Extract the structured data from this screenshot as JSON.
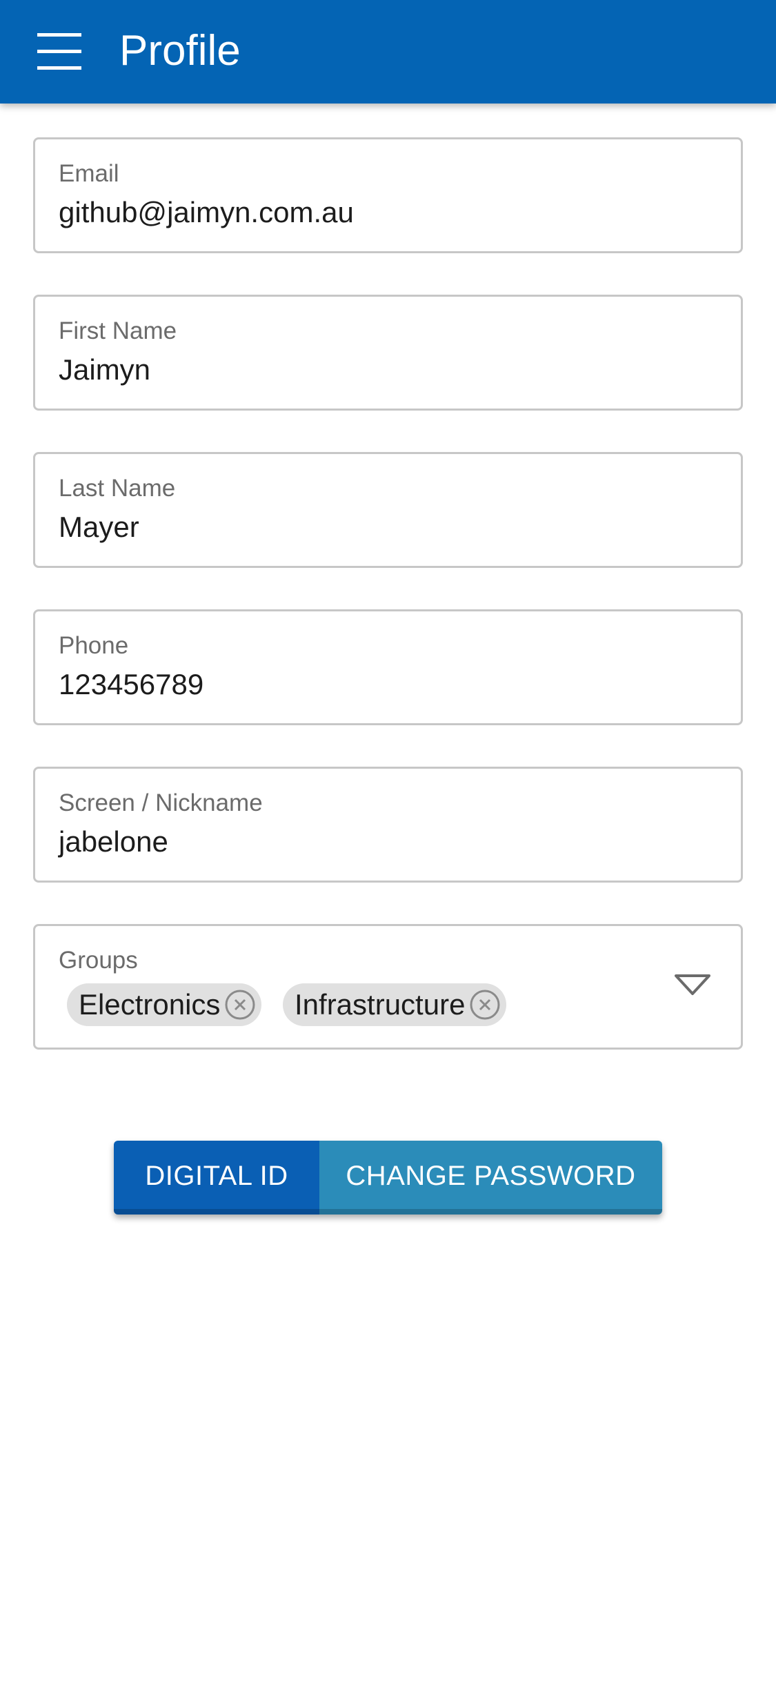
{
  "header": {
    "title": "Profile",
    "menu_icon": "hamburger-menu-icon",
    "color": "#0464b4"
  },
  "form": {
    "email": {
      "label": "Email",
      "value": "github@jaimyn.com.au"
    },
    "first_name": {
      "label": "First Name",
      "value": "Jaimyn"
    },
    "last_name": {
      "label": "Last Name",
      "value": "Mayer"
    },
    "phone": {
      "label": "Phone",
      "value": "123456789"
    },
    "nickname": {
      "label": "Screen / Nickname",
      "value": "jabelone"
    },
    "groups": {
      "label": "Groups",
      "chips": [
        {
          "label": "Electronics",
          "remove_icon": "close-circle-icon"
        },
        {
          "label": "Infrastructure",
          "remove_icon": "close-circle-icon"
        }
      ],
      "dropdown_icon": "chevron-down-icon"
    }
  },
  "actions": {
    "digital_id": {
      "label": "DIGITAL ID",
      "color": "#0a5fb4"
    },
    "change_password": {
      "label": "CHANGE PASSWORD",
      "color": "#2b8cb9"
    }
  }
}
